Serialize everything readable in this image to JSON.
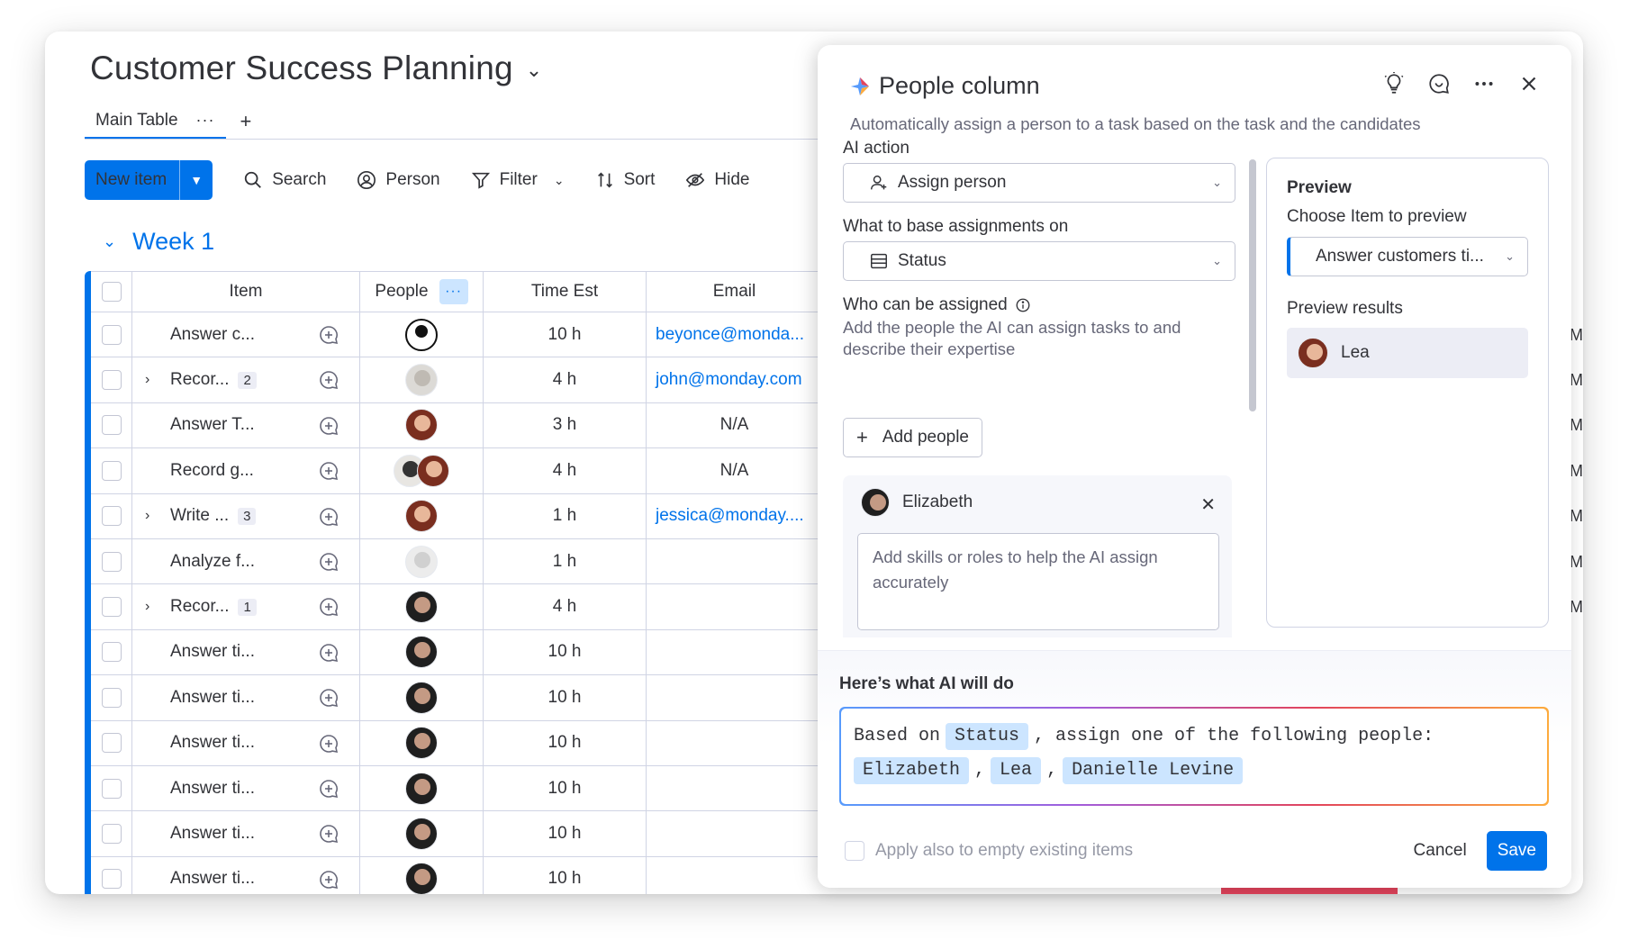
{
  "board": {
    "title": "Customer Success Planning",
    "tab_main": "Main Table",
    "tab_more": "···",
    "tab_add": "+",
    "new_item": "New item",
    "toolbar": {
      "search": "Search",
      "person": "Person",
      "filter": "Filter",
      "sort": "Sort",
      "hide": "Hide"
    },
    "group_title": "Week 1",
    "columns": {
      "item": "Item",
      "people": "People",
      "people_menu": "···",
      "time": "Time Est",
      "email": "Email"
    }
  },
  "rows": [
    {
      "name": "Answer c...",
      "sub": "",
      "avatar": "generic",
      "time": "10 h",
      "email": "beyonce@monda...",
      "email_link": true
    },
    {
      "name": "Recor...",
      "sub": "2",
      "avatar": "light",
      "time": "4 h",
      "email": "john@monday.com",
      "email_link": true
    },
    {
      "name": "Answer T...",
      "sub": "",
      "avatar": "warm",
      "time": "3 h",
      "email": "N/A",
      "email_link": false
    },
    {
      "name": "Record g...",
      "sub": "",
      "avatar": "pair",
      "time": "4 h",
      "email": "N/A",
      "email_link": false
    },
    {
      "name": "Write ...",
      "sub": "3",
      "avatar": "warm",
      "time": "1 h",
      "email": "jessica@monday....",
      "email_link": true
    },
    {
      "name": "Analyze f...",
      "sub": "",
      "avatar": "grey",
      "time": "1 h",
      "email": "",
      "email_link": false
    },
    {
      "name": "Recor...",
      "sub": "1",
      "avatar": "dark",
      "time": "4 h",
      "email": "",
      "email_link": false
    },
    {
      "name": "Answer ti...",
      "sub": "",
      "avatar": "dark",
      "time": "10 h",
      "email": "",
      "email_link": false
    },
    {
      "name": "Answer ti...",
      "sub": "",
      "avatar": "dark",
      "time": "10 h",
      "email": "",
      "email_link": false
    },
    {
      "name": "Answer ti...",
      "sub": "",
      "avatar": "dark",
      "time": "10 h",
      "email": "",
      "email_link": false
    },
    {
      "name": "Answer ti...",
      "sub": "",
      "avatar": "dark",
      "time": "10 h",
      "email": "",
      "email_link": false
    },
    {
      "name": "Answer ti...",
      "sub": "",
      "avatar": "dark",
      "time": "10 h",
      "email": "",
      "email_link": false
    },
    {
      "name": "Answer ti...",
      "sub": "",
      "avatar": "dark",
      "time": "10 h",
      "email": "",
      "email_link": false
    }
  ],
  "right_peek": [
    "M",
    "M",
    "M",
    "M",
    "M",
    "M",
    "M"
  ],
  "panel": {
    "title": "People column",
    "subtitle": "Automatically assign a person to a task based on the task and the candidates",
    "ai_action_label": "AI action",
    "ai_action_value": "Assign person",
    "base_label": "What to base assignments on",
    "base_value": "Status",
    "who_label": "Who can be assigned",
    "who_desc_1": "Add the people the AI can assign tasks to and",
    "who_desc_2": "describe their expertise",
    "add_people": "Add people",
    "person_name": "Elizabeth",
    "person_placeholder": "Add skills or roles to help the AI assign accurately",
    "preview_title": "Preview",
    "preview_choose": "Choose Item to preview",
    "preview_item": "Answer customers ti...",
    "preview_results_label": "Preview results",
    "preview_result_name": "Lea",
    "ai_title": "Here’s what AI will do",
    "ai_text_1": "Based on",
    "ai_chip_status": "Status",
    "ai_text_2": ", assign one of the following people:",
    "ai_people": [
      "Elizabeth",
      "Lea",
      "Danielle Levine"
    ],
    "apply_label": "Apply also to empty existing items",
    "cancel": "Cancel",
    "save": "Save"
  },
  "colors": {
    "primary": "#0073ea",
    "chip": "#cce5ff",
    "text": "#323338",
    "muted": "#676879"
  }
}
